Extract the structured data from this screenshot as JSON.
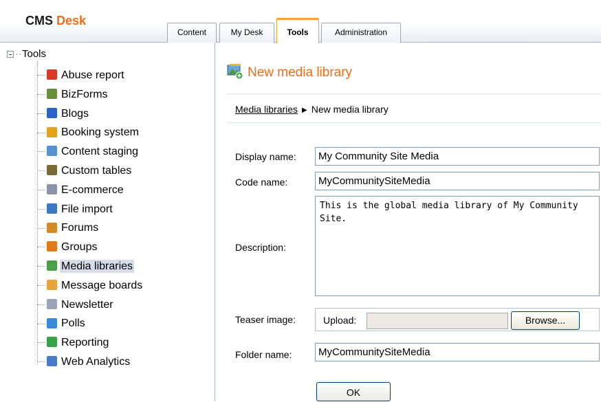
{
  "brand": {
    "cms": "CMS",
    "desk": "Desk"
  },
  "tabs": [
    {
      "label": "Content"
    },
    {
      "label": "My Desk"
    },
    {
      "label": "Tools",
      "active": true
    },
    {
      "label": "Administration"
    }
  ],
  "tree": {
    "root_label": "Tools",
    "items": [
      {
        "label": "Abuse report",
        "icon": "abuse-report-icon",
        "color": "#d83a2a"
      },
      {
        "label": "BizForms",
        "icon": "bizforms-icon",
        "color": "#6b8e3d"
      },
      {
        "label": "Blogs",
        "icon": "blogs-icon",
        "color": "#2a64c8"
      },
      {
        "label": "Booking system",
        "icon": "booking-system-icon",
        "color": "#e3a21a"
      },
      {
        "label": "Content staging",
        "icon": "content-staging-icon",
        "color": "#5a8fd0"
      },
      {
        "label": "Custom tables",
        "icon": "custom-tables-icon",
        "color": "#7a6a3a"
      },
      {
        "label": "E-commerce",
        "icon": "ecommerce-icon",
        "color": "#8a96a8"
      },
      {
        "label": "File import",
        "icon": "file-import-icon",
        "color": "#3e78c2"
      },
      {
        "label": "Forums",
        "icon": "forums-icon",
        "color": "#d08a2a"
      },
      {
        "label": "Groups",
        "icon": "groups-icon",
        "color": "#e07a1a"
      },
      {
        "label": "Media libraries",
        "icon": "media-libraries-icon",
        "color": "#4aa04a",
        "selected": true
      },
      {
        "label": "Message boards",
        "icon": "message-boards-icon",
        "color": "#e8a33a"
      },
      {
        "label": "Newsletter",
        "icon": "newsletter-icon",
        "color": "#9aa6b8"
      },
      {
        "label": "Polls",
        "icon": "polls-icon",
        "color": "#3a8ad8"
      },
      {
        "label": "Reporting",
        "icon": "reporting-icon",
        "color": "#3aa04a"
      },
      {
        "label": "Web Analytics",
        "icon": "web-analytics-icon",
        "color": "#4a7ac8"
      }
    ]
  },
  "page": {
    "title": "New media library",
    "breadcrumb": {
      "link": "Media libraries",
      "current": "New media library"
    }
  },
  "form": {
    "display_name_label": "Display name:",
    "display_name_value": "My Community Site Media",
    "code_name_label": "Code name:",
    "code_name_value": "MyCommunitySiteMedia",
    "description_label": "Description:",
    "description_value": "This is the global media library of My Community Site.",
    "teaser_label": "Teaser image:",
    "upload_label": "Upload:",
    "browse_label": "Browse...",
    "folder_label": "Folder name:",
    "folder_value": "MyCommunitySiteMedia",
    "ok_label": "OK"
  }
}
